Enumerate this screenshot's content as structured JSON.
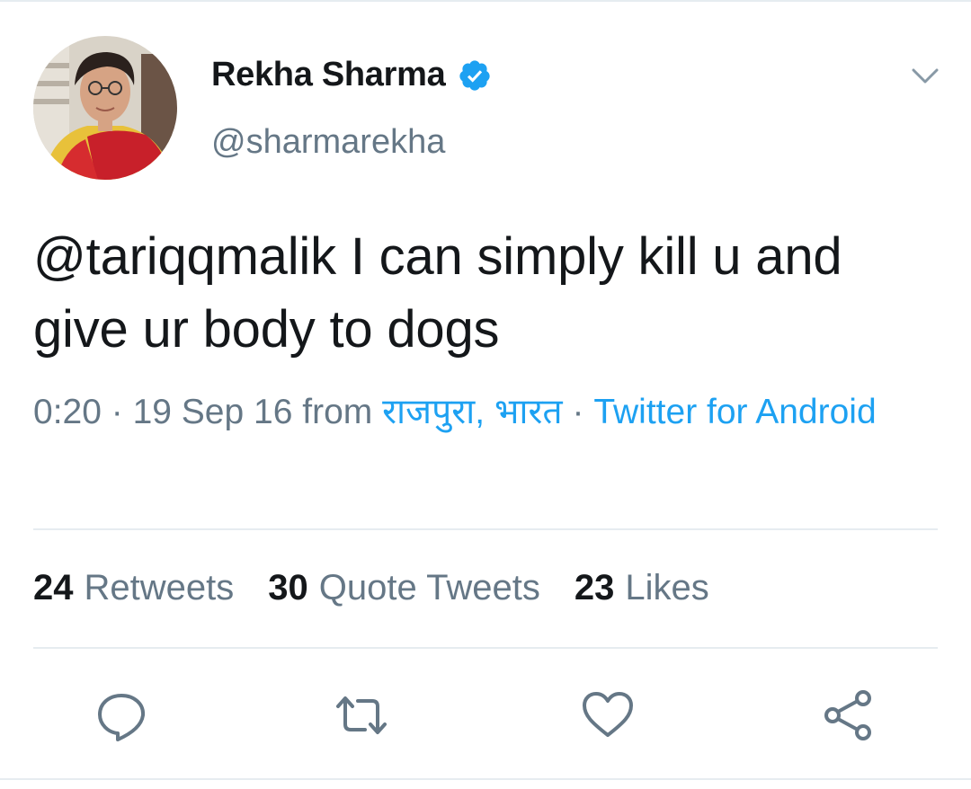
{
  "author": {
    "display_name": "Rekha Sharma",
    "handle": "@sharmarekha",
    "verified": true
  },
  "tweet": {
    "text": "@tariqqmalik I can simply kill u and give ur body to dogs",
    "time": "0:20",
    "date": "19 Sep 16",
    "from_word": "from",
    "location": "राजपुरा, भारत",
    "client": "Twitter for Android"
  },
  "stats": [
    {
      "count": "24",
      "label": "Retweets"
    },
    {
      "count": "30",
      "label": "Quote Tweets"
    },
    {
      "count": "23",
      "label": "Likes"
    }
  ],
  "icons": {
    "verified": "verified-badge-icon",
    "menu": "chevron-down-icon",
    "reply": "reply-icon",
    "retweet": "retweet-icon",
    "like": "heart-icon",
    "share": "share-icon"
  },
  "colors": {
    "link": "#1da1f2",
    "secondary_text": "#657786",
    "primary_text": "#14171a",
    "divider": "#e6ecf0"
  }
}
